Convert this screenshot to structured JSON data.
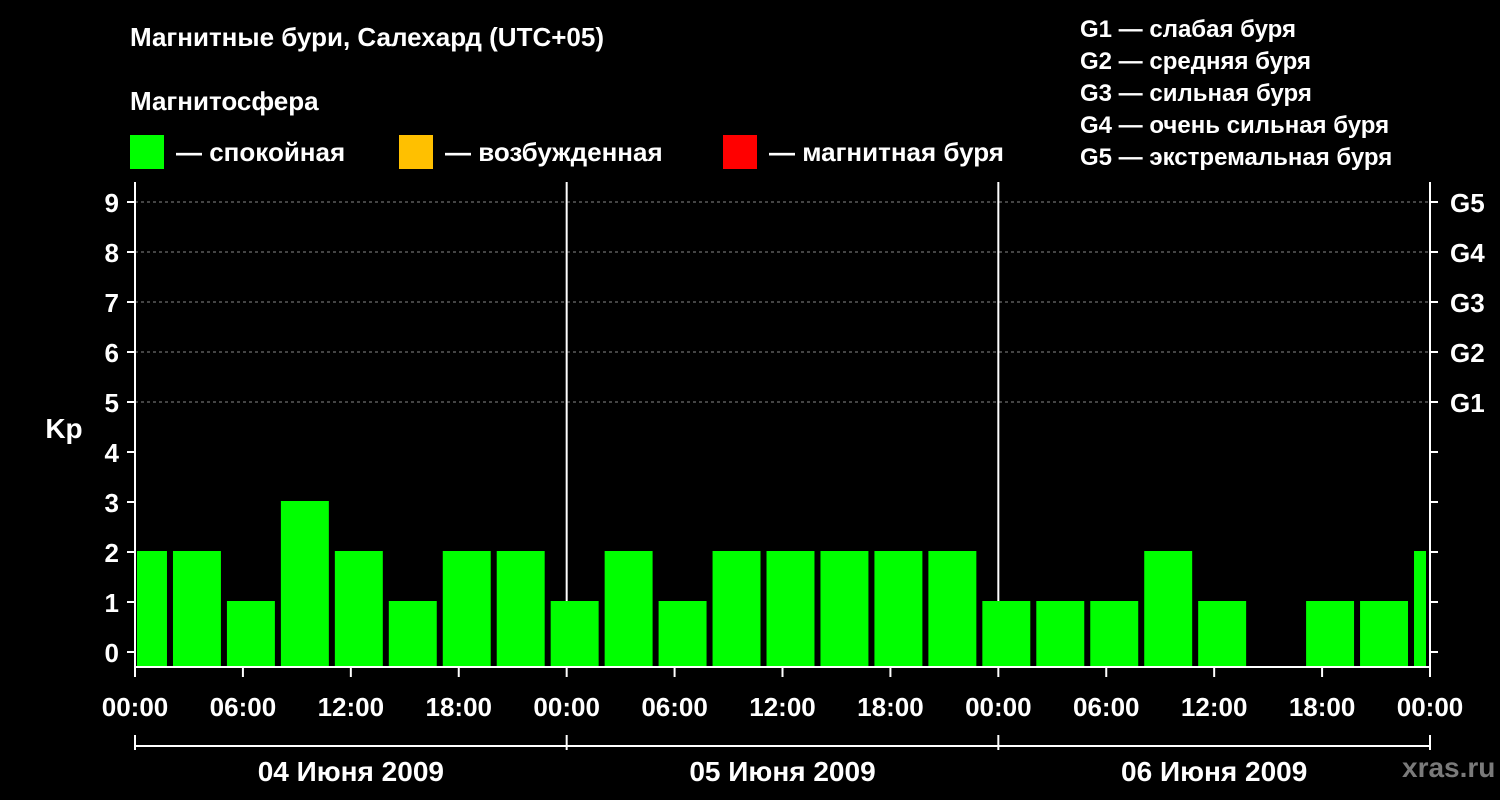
{
  "header": {
    "title": "Магнитные бури, Салехард (UTC+05)",
    "subtitle": "Магнитосфера"
  },
  "legend": {
    "calm": {
      "label": "— спокойная",
      "color": "#00ff00"
    },
    "excited": {
      "label": "— возбужденная",
      "color": "#ffc000"
    },
    "storm": {
      "label": "— магнитная буря",
      "color": "#ff0000"
    }
  },
  "g_legend": [
    "G1 — слабая буря",
    "G2 — средняя буря",
    "G3 — сильная буря",
    "G4 — очень сильная буря",
    "G5 — экстремальная буря"
  ],
  "watermark": "xras.ru",
  "chart_data": {
    "type": "bar",
    "ylabel": "Kp",
    "ylim": [
      0,
      9
    ],
    "yticks": [
      0,
      1,
      2,
      3,
      4,
      5,
      6,
      7,
      8,
      9
    ],
    "right_ticks": [
      {
        "value": 5,
        "label": "G1"
      },
      {
        "value": 6,
        "label": "G2"
      },
      {
        "value": 7,
        "label": "G3"
      },
      {
        "value": 8,
        "label": "G4"
      },
      {
        "value": 9,
        "label": "G5"
      }
    ],
    "gridlines": [
      5,
      6,
      7,
      8,
      9
    ],
    "x_tick_labels": [
      "00:00",
      "06:00",
      "12:00",
      "18:00",
      "00:00",
      "06:00",
      "12:00",
      "18:00",
      "00:00",
      "06:00",
      "12:00",
      "18:00",
      "00:00"
    ],
    "days": [
      "04 Июня 2009",
      "05 Июня 2009",
      "06 Июня 2009"
    ],
    "bar_color": "#00ff00",
    "bars": [
      {
        "start_hour": 0,
        "end_hour": 2,
        "kp": 2
      },
      {
        "start_hour": 2,
        "end_hour": 5,
        "kp": 2
      },
      {
        "start_hour": 5,
        "end_hour": 8,
        "kp": 1
      },
      {
        "start_hour": 8,
        "end_hour": 11,
        "kp": 3
      },
      {
        "start_hour": 11,
        "end_hour": 14,
        "kp": 2
      },
      {
        "start_hour": 14,
        "end_hour": 17,
        "kp": 1
      },
      {
        "start_hour": 17,
        "end_hour": 20,
        "kp": 2
      },
      {
        "start_hour": 20,
        "end_hour": 23,
        "kp": 2
      },
      {
        "start_hour": 23,
        "end_hour": 26,
        "kp": 1
      },
      {
        "start_hour": 26,
        "end_hour": 29,
        "kp": 2
      },
      {
        "start_hour": 29,
        "end_hour": 32,
        "kp": 1
      },
      {
        "start_hour": 32,
        "end_hour": 35,
        "kp": 2
      },
      {
        "start_hour": 35,
        "end_hour": 38,
        "kp": 2
      },
      {
        "start_hour": 38,
        "end_hour": 41,
        "kp": 2
      },
      {
        "start_hour": 41,
        "end_hour": 44,
        "kp": 2
      },
      {
        "start_hour": 44,
        "end_hour": 47,
        "kp": 2
      },
      {
        "start_hour": 47,
        "end_hour": 50,
        "kp": 1
      },
      {
        "start_hour": 50,
        "end_hour": 53,
        "kp": 1
      },
      {
        "start_hour": 53,
        "end_hour": 56,
        "kp": 1
      },
      {
        "start_hour": 56,
        "end_hour": 59,
        "kp": 2
      },
      {
        "start_hour": 59,
        "end_hour": 62,
        "kp": 1
      },
      {
        "start_hour": 62,
        "end_hour": 65,
        "kp": 0
      },
      {
        "start_hour": 65,
        "end_hour": 68,
        "kp": 1
      },
      {
        "start_hour": 68,
        "end_hour": 71,
        "kp": 1
      },
      {
        "start_hour": 71,
        "end_hour": 72,
        "kp": 2
      }
    ]
  }
}
